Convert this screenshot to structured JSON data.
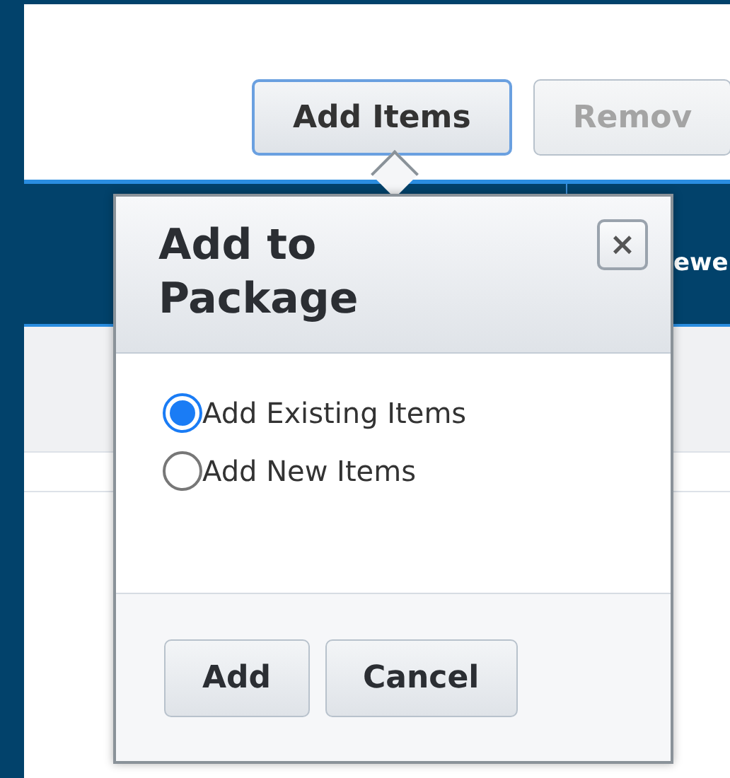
{
  "toolbar": {
    "buttons": [
      {
        "label": "Add Items",
        "active": true,
        "disabled": false
      },
      {
        "label": "Remov",
        "active": false,
        "disabled": true
      }
    ]
  },
  "table": {
    "columns": [
      {
        "label": "ewe"
      }
    ]
  },
  "popup": {
    "title": "Add to Package",
    "close_label": "×",
    "options": [
      {
        "label": "Add Existing Items",
        "selected": true
      },
      {
        "label": "Add New Items",
        "selected": false
      }
    ],
    "buttons": [
      "Add",
      "Cancel"
    ]
  }
}
